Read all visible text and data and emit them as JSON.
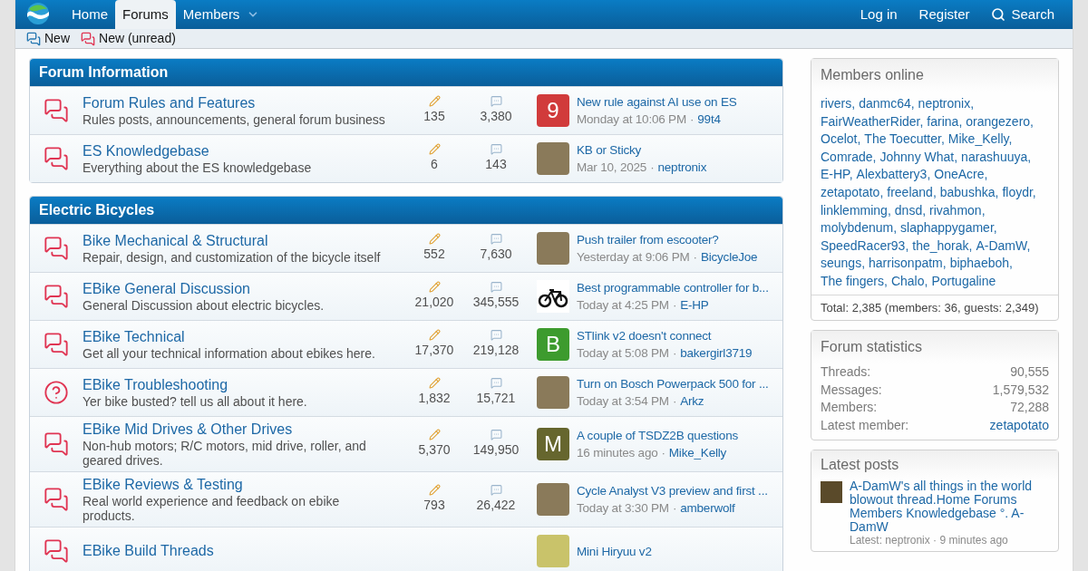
{
  "nav": {
    "tabs": [
      {
        "label": "Home",
        "selected": false,
        "dropdown": false
      },
      {
        "label": "Forums",
        "selected": true,
        "dropdown": false
      },
      {
        "label": "Members",
        "selected": false,
        "dropdown": true
      }
    ],
    "right": [
      {
        "label": "Log in",
        "kind": "link"
      },
      {
        "label": "Register",
        "kind": "link"
      },
      {
        "label": "Search",
        "kind": "search"
      }
    ]
  },
  "subnav": [
    {
      "label": "New",
      "color": "#2577b1"
    },
    {
      "label": "New (unread)",
      "color": "#e03553"
    }
  ],
  "separator": "·",
  "sections": [
    {
      "title": "Forum Information",
      "forums": [
        {
          "kind": "chat",
          "title": "Forum Rules and Features",
          "description": "Rules posts, announcements, general forum business",
          "threads": "135",
          "messages": "3,380",
          "last": {
            "kind": "letter",
            "letter": "9",
            "color": "#d13b3b",
            "title": "New rule against AI use on ES",
            "date": "Monday at 10:06 PM",
            "user": "99t4"
          }
        },
        {
          "kind": "chat",
          "title": "ES Knowledgebase",
          "description": "Everything about the ES knowledgebase",
          "threads": "6",
          "messages": "143",
          "last": {
            "kind": "photo",
            "title": "KB or Sticky",
            "date": "Mar 10, 2025",
            "user": "neptronix"
          }
        }
      ]
    },
    {
      "title": "Electric Bicycles",
      "forums": [
        {
          "kind": "chat",
          "title": "Bike Mechanical & Structural",
          "description": "Repair, design, and customization of the bicycle itself",
          "threads": "552",
          "messages": "7,630",
          "last": {
            "kind": "photo",
            "title": "Push trailer from escooter?",
            "date": "Yesterday at 9:06 PM",
            "user": "BicycleJoe"
          }
        },
        {
          "kind": "chat",
          "title": "EBike General Discussion",
          "description": "General Discussion about electric bicycles.",
          "threads": "21,020",
          "messages": "345,555",
          "last": {
            "kind": "bike",
            "title": "Best programmable controller for b...",
            "date": "Today at 4:25 PM",
            "user": "E-HP"
          }
        },
        {
          "kind": "chat",
          "title": "EBike Technical",
          "description": "Get all your technical information about ebikes here.",
          "threads": "17,370",
          "messages": "219,128",
          "last": {
            "kind": "letter",
            "letter": "B",
            "color": "#3d9b2e",
            "title": "STlink v2 doesn't connect",
            "date": "Today at 5:08 PM",
            "user": "bakergirl3719"
          }
        },
        {
          "kind": "question",
          "title": "EBike Troubleshooting",
          "description": "Yer bike busted? tell us all about it here.",
          "threads": "1,832",
          "messages": "15,721",
          "last": {
            "kind": "photo",
            "title": "Turn on Bosch Powerpack 500 for ...",
            "date": "Today at 3:54 PM",
            "user": "Arkz"
          }
        },
        {
          "kind": "chat",
          "title": "EBike Mid Drives & Other Drives",
          "description": "Non-hub motors; R/C motors, mid drive, roller, and geared drives.",
          "threads": "5,370",
          "messages": "149,950",
          "last": {
            "kind": "letter",
            "letter": "M",
            "color": "#66662e",
            "title": "A couple of TSDZ2B questions",
            "date": "16 minutes ago",
            "user": "Mike_Kelly"
          }
        },
        {
          "kind": "chat",
          "title": "EBike Reviews & Testing",
          "description": "Real world experience and feedback on ebike products.",
          "threads": "793",
          "messages": "26,422",
          "last": {
            "kind": "photo",
            "title": "Cycle Analyst V3 preview and first ...",
            "date": "Today at 3:30 PM",
            "user": "amberwolf"
          }
        },
        {
          "kind": "chat",
          "title": "EBike Build Threads",
          "last": {
            "kind": "letter",
            "color": "#c9c36a",
            "title": "Mini Hiryuu v2"
          }
        }
      ]
    }
  ],
  "members_online": {
    "title": "Members online",
    "names": [
      "rivers",
      "danmc64",
      "neptronix",
      "FairWeatherRider",
      "farina",
      "orangezero",
      "Ocelot",
      "The Toecutter",
      "Mike_Kelly",
      "Comrade",
      "Johnny What",
      "narashuuya",
      "E-HP",
      "Alexbattery3",
      "OneAcre",
      "zetapotato",
      "freeland",
      "babushka",
      "floydr",
      "linklemming",
      "dnsd",
      "rivahmon",
      "molybdenum",
      "slaphappygamer",
      "SpeedRacer93",
      "the_horak",
      "A-DamW",
      "seungs",
      "harrisonpatm",
      "biphaeboh",
      "The fingers",
      "Chalo",
      "Portugaline"
    ],
    "name_separator": ",",
    "total": "Total: 2,385 (members: 36, guests: 2,349)"
  },
  "forum_statistics": {
    "title": "Forum statistics",
    "rows": [
      {
        "label": "Threads:",
        "value": "90,555",
        "link": false
      },
      {
        "label": "Messages:",
        "value": "1,579,532",
        "link": false
      },
      {
        "label": "Members:",
        "value": "72,288",
        "link": false
      },
      {
        "label": "Latest member:",
        "value": "zetapotato",
        "link": true
      }
    ]
  },
  "latest_posts": {
    "title": "Latest posts",
    "posts": [
      {
        "title": "A-DamW's all things in the world blowout thread.Home Forums Members Knowledgebase °. A-DamW",
        "meta": "Latest: neptronix · 9 minutes ago"
      }
    ]
  }
}
